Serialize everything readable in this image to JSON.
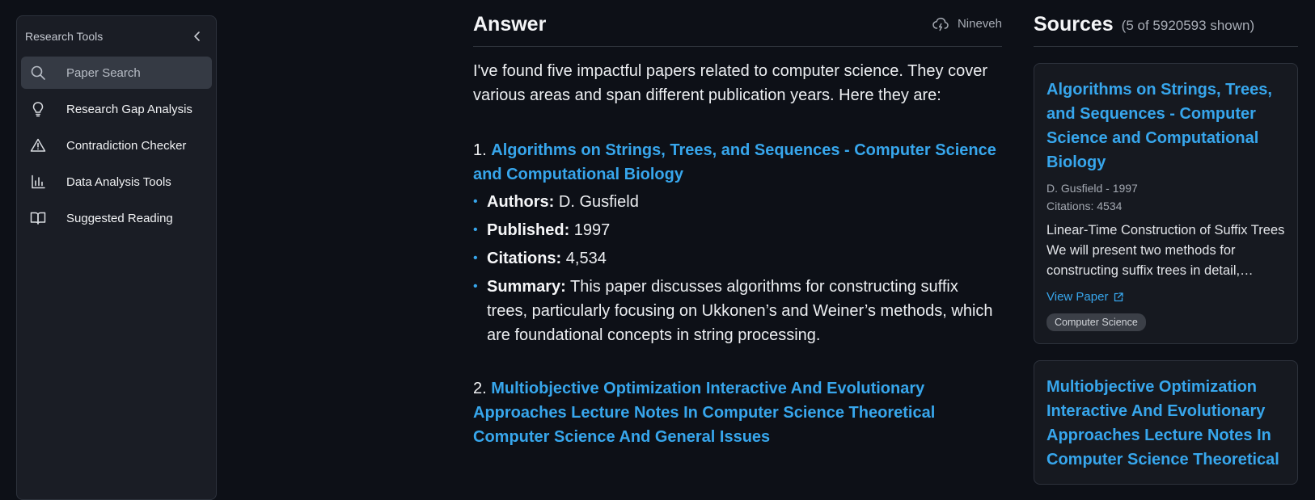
{
  "sidebar": {
    "title": "Research Tools",
    "items": [
      {
        "label": "Paper Search",
        "icon": "search-icon"
      },
      {
        "label": "Research Gap Analysis",
        "icon": "lightbulb-icon"
      },
      {
        "label": "Contradiction Checker",
        "icon": "warning-triangle-icon"
      },
      {
        "label": "Data Analysis Tools",
        "icon": "bar-chart-icon"
      },
      {
        "label": "Suggested Reading",
        "icon": "open-book-icon"
      }
    ]
  },
  "answer": {
    "title": "Answer",
    "model": "Nineveh",
    "intro": "I've found five impactful papers related to computer science. They cover various areas and span different publication years. Here they are:",
    "papers": [
      {
        "num": "1.",
        "title": "Algorithms on Strings, Trees, and Sequences - Computer Science and Computational Biology",
        "authors_label": "Authors:",
        "authors": "D. Gusfield",
        "published_label": "Published:",
        "published": "1997",
        "citations_label": "Citations:",
        "citations": "4,534",
        "summary_label": "Summary:",
        "summary": "This paper discusses algorithms for constructing suffix trees, particularly focusing on Ukkonen’s and Weiner’s methods, which are foundational concepts in string processing."
      },
      {
        "num": "2.",
        "title": "Multiobjective Optimization Interactive And Evolutionary Approaches Lecture Notes In Computer Science Theoretical Computer Science And General Issues"
      }
    ]
  },
  "sources": {
    "title": "Sources",
    "count": "(5 of 5920593 shown)",
    "cards": [
      {
        "title": "Algorithms on Strings, Trees, and Sequences - Computer Science and Computational Biology",
        "byline": "D. Gusfield - 1997",
        "citations": "Citations: 4534",
        "summary": "Linear-Time Construction of Suffix Trees We will present two methods for constructing suffix trees in detail, Ukkonen's method and Weiner's method.",
        "view": "View Paper",
        "tag": "Computer Science"
      },
      {
        "title": "Multiobjective Optimization Interactive And Evolutionary Approaches Lecture Notes In Computer Science Theoretical"
      }
    ]
  },
  "colors": {
    "accent": "#37a6ec",
    "background": "#0d1017",
    "panel": "#1a1d25"
  }
}
